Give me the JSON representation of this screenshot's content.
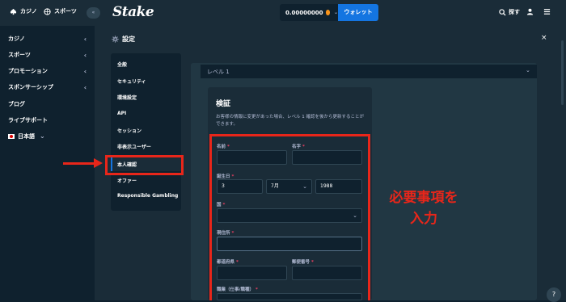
{
  "topbar": {
    "casino_label": "カジノ",
    "sports_label": "スポーツ",
    "collapse_label": "«",
    "logo": "Stake",
    "balance": "0.00000000",
    "wallet_label": "ウォレット",
    "search_label": "探す"
  },
  "sidebar": {
    "items": [
      {
        "label": "カジノ",
        "arrow": "‹"
      },
      {
        "label": "スポーツ",
        "arrow": "‹"
      },
      {
        "label": "プロモーション",
        "arrow": "‹"
      },
      {
        "label": "スポンサーシップ",
        "arrow": "‹"
      },
      {
        "label": "ブログ",
        "arrow": ""
      },
      {
        "label": "ライブサポート",
        "arrow": ""
      }
    ],
    "language": "日本語"
  },
  "settings": {
    "title": "設定",
    "close": "×",
    "menu": [
      "全般",
      "セキュリティ",
      "環境設定",
      "API",
      "セッション",
      "非表示ユーザー",
      "本人確認",
      "オファー",
      "Responsible Gambling"
    ],
    "active_menu": "本人確認"
  },
  "level": {
    "label": "レベル 1"
  },
  "verification": {
    "title": "検証",
    "description": "お客様の情報に変更があった場合、レベル 1 確認を後から更新することができます。",
    "fields": {
      "first_name_label": "名前",
      "last_name_label": "名字",
      "dob_label": "誕生日",
      "dob_day": "3",
      "dob_month": "7月",
      "dob_year": "1988",
      "country_label": "国",
      "address_label": "現住所",
      "prefecture_label": "都道府県",
      "postal_label": "郵便番号",
      "occupation_label": "職業（仕事/職種）"
    },
    "required_mark": "*"
  },
  "annotation": {
    "line1": "必要事項を",
    "line2": "入力"
  },
  "colors": {
    "accent": "#1475e1",
    "annotation": "#e8261a",
    "background": "#0f212e",
    "panel": "#1a2c38"
  }
}
